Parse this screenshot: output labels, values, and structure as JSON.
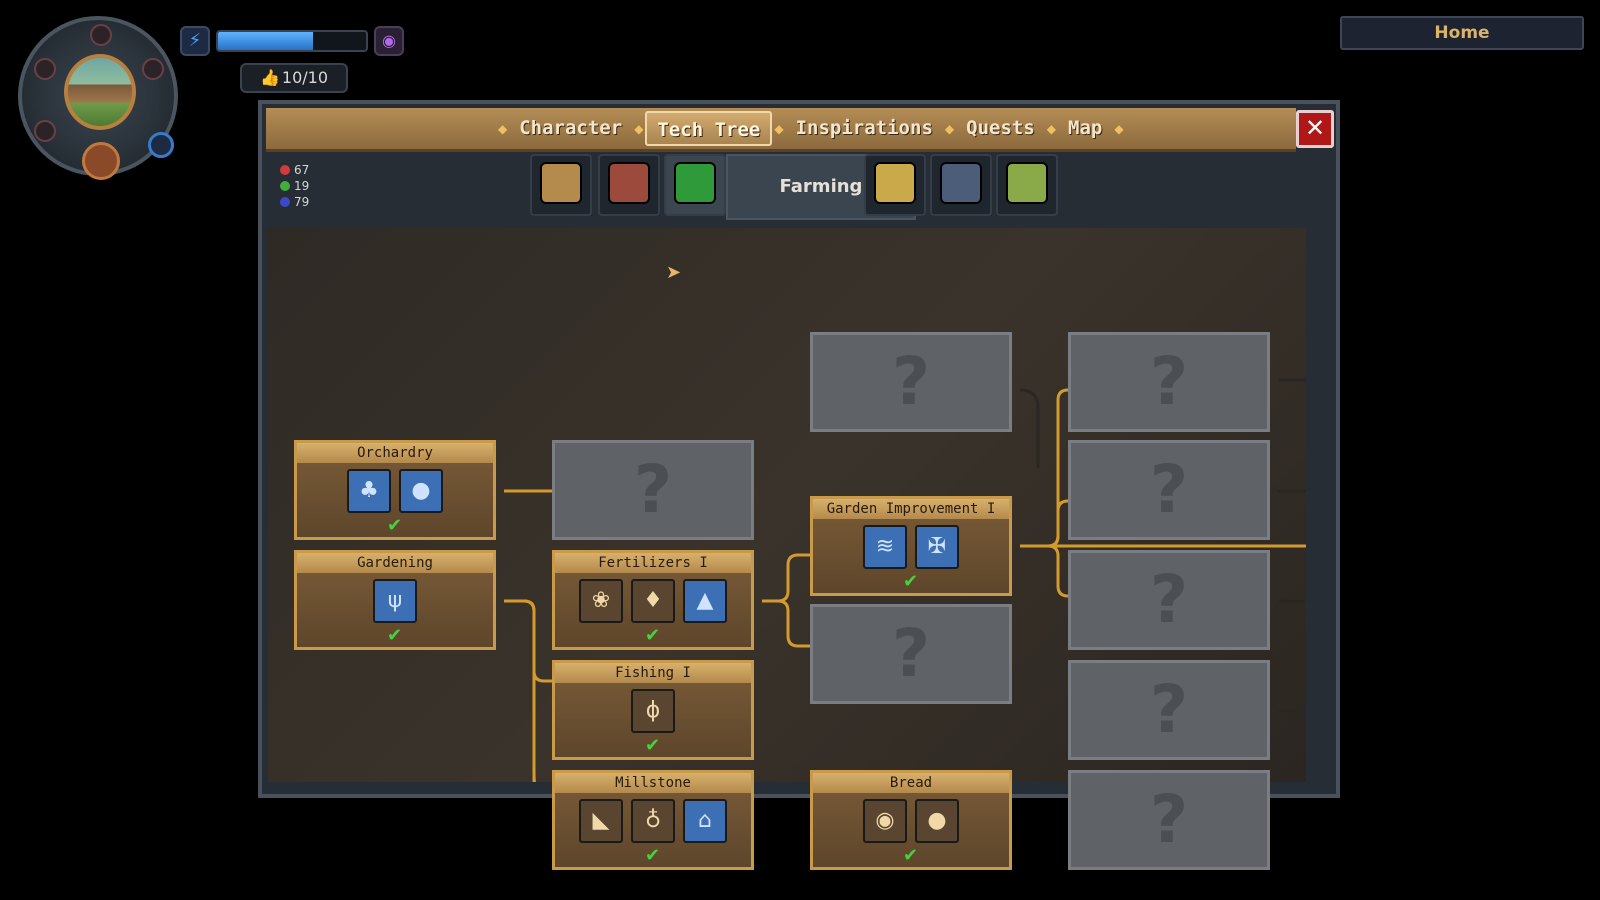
{
  "hud": {
    "rating": "10/10",
    "energy_fraction": 0.64,
    "energy_color": "#3d8ee6",
    "icons": [
      "lightning-icon",
      "magic-orb-icon",
      "thumbs-up-icon"
    ]
  },
  "home_button": {
    "label": "Home"
  },
  "tabs": [
    {
      "label": "Character",
      "active": false
    },
    {
      "label": "Tech Tree",
      "active": true
    },
    {
      "label": "Inspirations",
      "active": false
    },
    {
      "label": "Quests",
      "active": false
    },
    {
      "label": "Map",
      "active": false
    }
  ],
  "close_button": {
    "label": "✕"
  },
  "resources": [
    {
      "value": "67",
      "color": "#d23b3b"
    },
    {
      "value": "19",
      "color": "#3fae3a"
    },
    {
      "value": "79",
      "color": "#3b49c9"
    }
  ],
  "category": {
    "active_label": "Farming",
    "tabs": [
      {
        "icon": "construction-icon",
        "color": "#b58a4d"
      },
      {
        "icon": "crafting-icon",
        "color": "#9b4a3c"
      },
      {
        "icon": "farming-leaf-icon",
        "color": "#2f9a3a"
      },
      {
        "icon": "inspiration-eye-icon",
        "color": "#c9a94a"
      },
      {
        "icon": "skull-icon",
        "color": "#4b5d78"
      },
      {
        "icon": "cooking-utensils-icon",
        "color": "#8aaa4a"
      }
    ]
  },
  "nodes": [
    {
      "name": "orchardry",
      "title": "Orchardry",
      "icons": [
        {
          "glyph": "♣",
          "type": "blueprint"
        },
        {
          "glyph": "●",
          "type": "blueprint"
        }
      ],
      "done": true
    },
    {
      "name": "gardening",
      "title": "Gardening",
      "icons": [
        {
          "glyph": "ψ",
          "type": "blueprint"
        }
      ],
      "done": true
    },
    {
      "name": "fertilizers",
      "title": "Fertilizers I",
      "icons": [
        {
          "glyph": "❀",
          "type": "item"
        },
        {
          "glyph": "♦",
          "type": "item"
        },
        {
          "glyph": "▲",
          "type": "blueprint"
        }
      ],
      "done": true
    },
    {
      "name": "fishing",
      "title": "Fishing I",
      "icons": [
        {
          "glyph": "ϕ",
          "type": "item"
        }
      ],
      "done": true
    },
    {
      "name": "millstone",
      "title": "Millstone",
      "icons": [
        {
          "glyph": "◣",
          "type": "item"
        },
        {
          "glyph": "♁",
          "type": "item"
        },
        {
          "glyph": "⌂",
          "type": "blueprint"
        }
      ],
      "done": true
    },
    {
      "name": "garden-improvement",
      "title": "Garden Improvement I",
      "icons": [
        {
          "glyph": "≋",
          "type": "blueprint"
        },
        {
          "glyph": "✠",
          "type": "blueprint"
        }
      ],
      "done": true
    },
    {
      "name": "bread",
      "title": "Bread",
      "icons": [
        {
          "glyph": "◉",
          "type": "item"
        },
        {
          "glyph": "●",
          "type": "item"
        }
      ],
      "done": true
    }
  ],
  "locked_label": "?",
  "check_mark": "✔"
}
